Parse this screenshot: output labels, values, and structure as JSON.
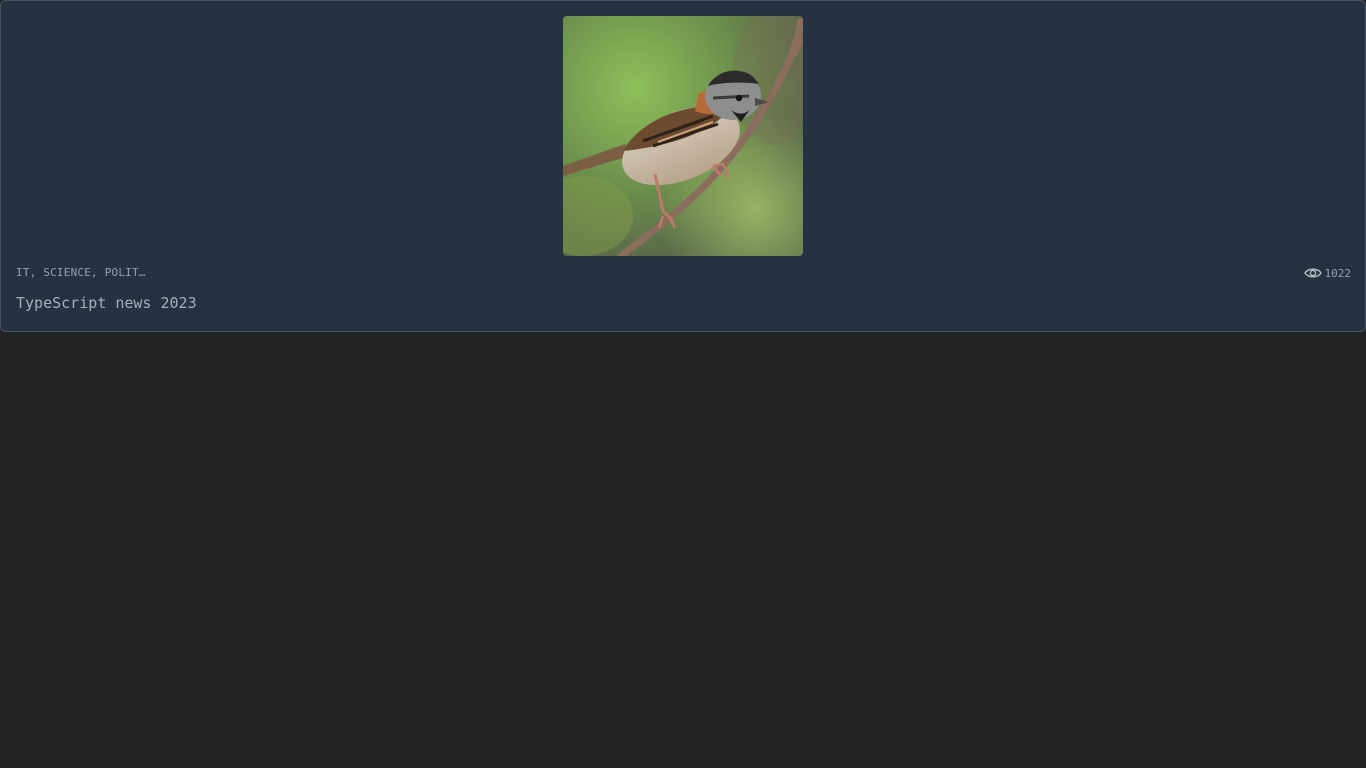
{
  "card": {
    "image_name": "sparrow-photo",
    "tags": "IT, SCIENCE, POLIT…",
    "views": "1022",
    "views_icon": "eye-icon",
    "title": "TypeScript news 2023"
  },
  "colors": {
    "page_bg": "#222324",
    "card_bg": "#253241",
    "card_border": "#4a5563",
    "muted_text": "#9aa1a9"
  }
}
